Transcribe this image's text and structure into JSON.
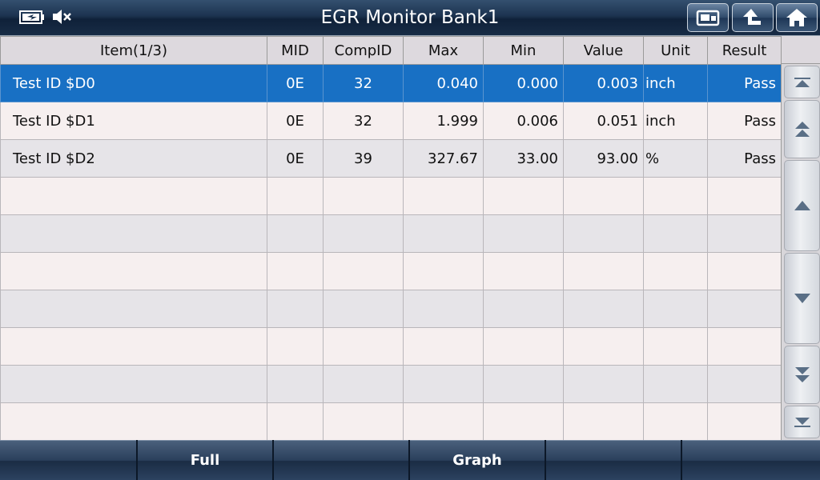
{
  "header": {
    "title": "EGR Monitor Bank1",
    "icons": {
      "battery": "battery-charging-icon",
      "mute": "speaker-muted-icon",
      "print": "print-icon",
      "back": "back-arrow-icon",
      "home": "home-icon"
    }
  },
  "table": {
    "columns": {
      "item": "Item(1/3)",
      "mid": "MID",
      "compid": "CompID",
      "max": "Max",
      "min": "Min",
      "value": "Value",
      "unit": "Unit",
      "result": "Result"
    },
    "rows": [
      {
        "item": "Test ID $D0",
        "mid": "0E",
        "compid": "32",
        "max": "0.040",
        "min": "0.000",
        "value": "0.003",
        "unit": "inch",
        "result": "Pass"
      },
      {
        "item": "Test ID $D1",
        "mid": "0E",
        "compid": "32",
        "max": "1.999",
        "min": "0.006",
        "value": "0.051",
        "unit": "inch",
        "result": "Pass"
      },
      {
        "item": "Test ID $D2",
        "mid": "0E",
        "compid": "39",
        "max": "327.67",
        "min": "33.00",
        "value": "93.00",
        "unit": "%",
        "result": "Pass"
      }
    ]
  },
  "footer": {
    "buttons": [
      "",
      "Full",
      "",
      "Graph",
      "",
      ""
    ]
  },
  "colors": {
    "selected_row": "#1870c4",
    "header_bar": "#1c3350"
  }
}
